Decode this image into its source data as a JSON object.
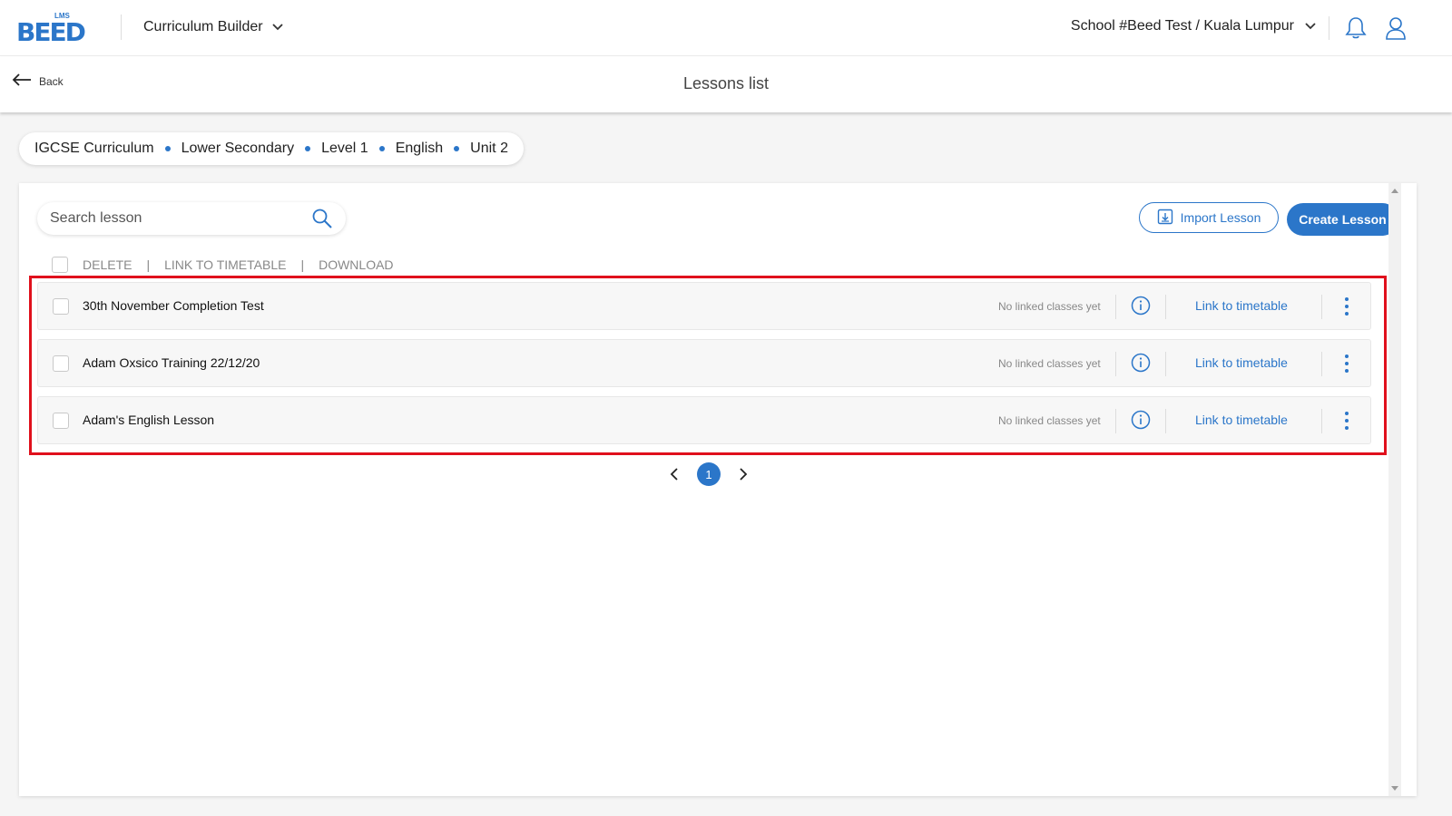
{
  "header": {
    "logo_text": "BEED",
    "logo_sup": "LMS",
    "module_label": "Curriculum Builder",
    "school_label": "School #Beed Test / Kuala Lumpur"
  },
  "subheader": {
    "back_label": "Back",
    "title": "Lessons list"
  },
  "breadcrumb": [
    "IGCSE Curriculum",
    "Lower Secondary",
    "Level 1",
    "English",
    "Unit 2"
  ],
  "search": {
    "placeholder": "Search lesson",
    "value": ""
  },
  "actions": {
    "import_label": "Import Lesson",
    "create_label": "Create Lesson"
  },
  "bulk": {
    "delete_label": "DELETE",
    "link_label": "LINK TO TIMETABLE",
    "download_label": "DOWNLOAD",
    "separator": "|"
  },
  "lessons": [
    {
      "name": "30th November Completion Test",
      "linked_status": "No linked classes yet",
      "link_label": "Link to timetable"
    },
    {
      "name": "Adam Oxsico Training 22/12/20",
      "linked_status": "No linked classes yet",
      "link_label": "Link to timetable"
    },
    {
      "name": "Adam's English Lesson",
      "linked_status": "No linked classes yet",
      "link_label": "Link to timetable"
    }
  ],
  "pagination": {
    "current_page": "1"
  },
  "colors": {
    "accent": "#2b76c9",
    "highlight": "#e0101c"
  }
}
